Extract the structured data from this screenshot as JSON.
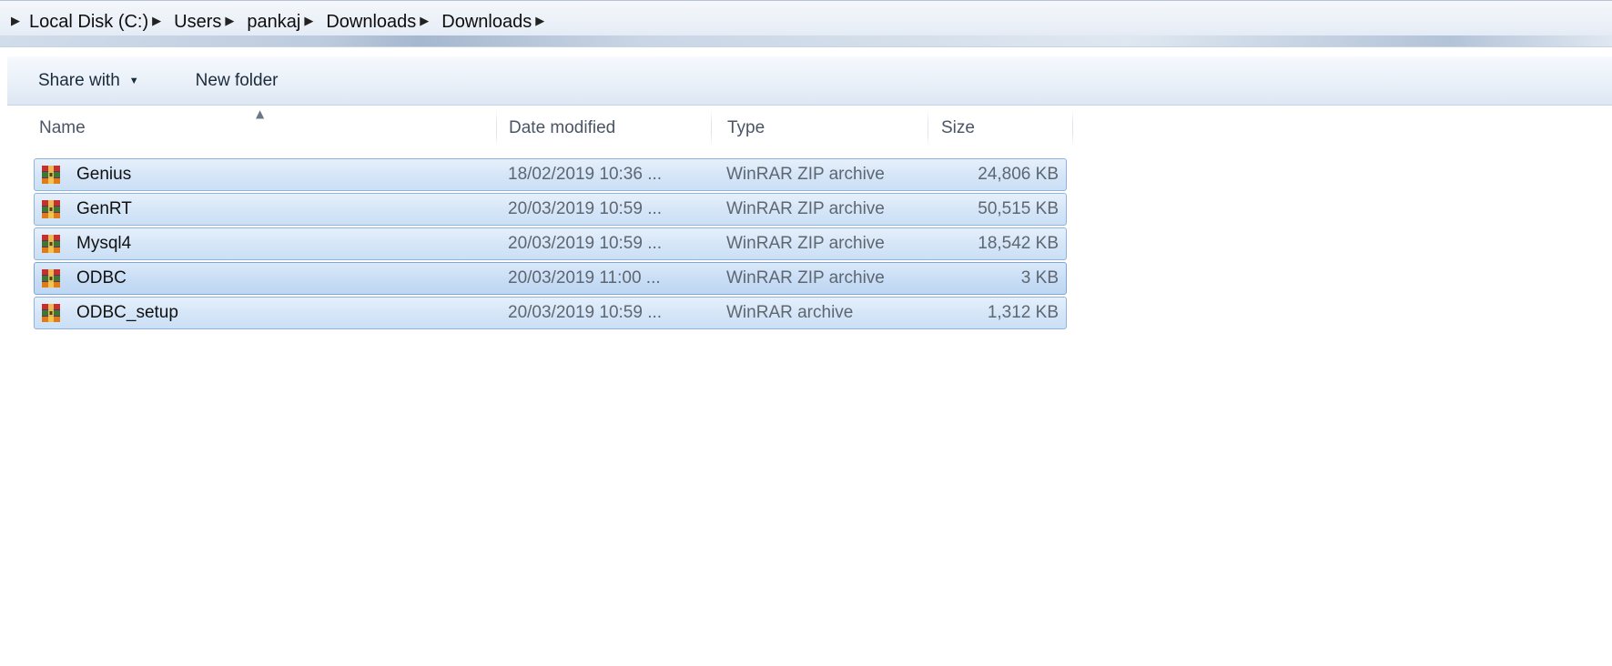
{
  "breadcrumb": [
    {
      "label": "Local Disk (C:)"
    },
    {
      "label": "Users"
    },
    {
      "label": "pankaj"
    },
    {
      "label": "Downloads"
    },
    {
      "label": "Downloads"
    }
  ],
  "toolbar": {
    "share_label": "Share with",
    "new_folder_label": "New folder"
  },
  "columns": {
    "name": "Name",
    "date": "Date modified",
    "type": "Type",
    "size": "Size"
  },
  "files": [
    {
      "name": "Genius",
      "date": "18/02/2019 10:36 ...",
      "type": "WinRAR ZIP archive",
      "size": "24,806 KB",
      "icon": "winrar-zip-icon"
    },
    {
      "name": "GenRT",
      "date": "20/03/2019 10:59 ...",
      "type": "WinRAR ZIP archive",
      "size": "50,515 KB",
      "icon": "winrar-zip-icon"
    },
    {
      "name": "Mysql4",
      "date": "20/03/2019 10:59 ...",
      "type": "WinRAR ZIP archive",
      "size": "18,542 KB",
      "icon": "winrar-zip-icon"
    },
    {
      "name": "ODBC",
      "date": "20/03/2019 11:00 ...",
      "type": "WinRAR ZIP archive",
      "size": "3 KB",
      "icon": "winrar-zip-icon"
    },
    {
      "name": "ODBC_setup",
      "date": "20/03/2019 10:59 ...",
      "type": "WinRAR archive",
      "size": "1,312 KB",
      "icon": "winrar-archive-icon"
    }
  ],
  "colors": {
    "selection_fill": "#d6e6f8",
    "selection_border": "#8fb4dc",
    "header_text": "#4a5565",
    "meta_text": "#5e6670"
  }
}
